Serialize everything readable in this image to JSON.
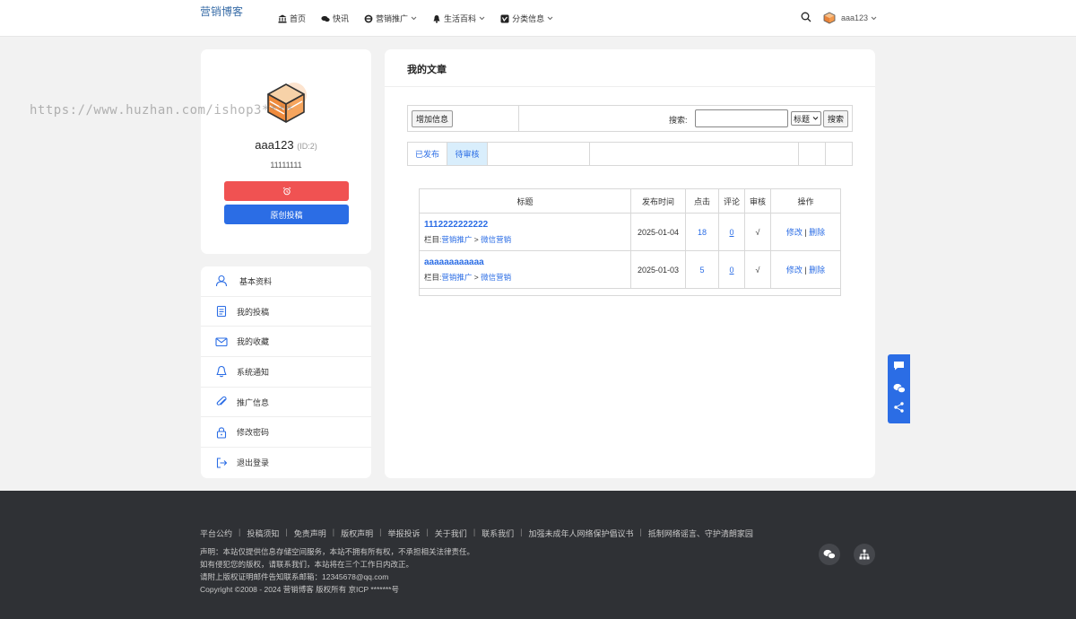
{
  "header": {
    "logo_text": "营销博客",
    "nav": [
      {
        "label": "首页",
        "icon": "bank-icon",
        "dropdown": false
      },
      {
        "label": "快讯",
        "icon": "chat-bubbles-icon",
        "dropdown": false
      },
      {
        "label": "营销推广",
        "icon": "ie-icon",
        "dropdown": true
      },
      {
        "label": "生活百科",
        "icon": "bell-icon",
        "dropdown": true
      },
      {
        "label": "分类信息",
        "icon": "vimeo-icon",
        "dropdown": true
      }
    ],
    "username": "aaa123"
  },
  "profile": {
    "name": "aaa123",
    "id_label": "(ID:2)",
    "description": "11111111",
    "submit_button": "原创投稿"
  },
  "menu": [
    {
      "label": "基本资料",
      "icon": "user-icon"
    },
    {
      "label": "我的投稿",
      "icon": "document-icon"
    },
    {
      "label": "我的收藏",
      "icon": "envelope-icon"
    },
    {
      "label": "系统通知",
      "icon": "bell-outline-icon"
    },
    {
      "label": "推广信息",
      "icon": "paperclip-icon"
    },
    {
      "label": "修改密码",
      "icon": "lock-icon"
    },
    {
      "label": "退出登录",
      "icon": "logout-icon"
    }
  ],
  "main": {
    "title": "我的文章",
    "add_button": "增加信息",
    "search_label": "搜索:",
    "search_value": "",
    "search_field_selected": "标题",
    "search_button": "搜索",
    "tabs": [
      "已发布",
      "待审核"
    ],
    "table": {
      "headers": [
        "标题",
        "发布时间",
        "点击",
        "评论",
        "审核",
        "操作"
      ],
      "category_prefix": "栏目:",
      "rows": [
        {
          "title": "1112222222222",
          "cat1": "营销推广",
          "cat2": "微信营销",
          "date": "2025-01-04",
          "clicks": "18",
          "comments": "0",
          "approved": "√",
          "edit": "修改",
          "delete": "删除"
        },
        {
          "title": "aaaaaaaaaaaa",
          "cat1": "营销推广",
          "cat2": "微信营销",
          "date": "2025-01-03",
          "clicks": "5",
          "comments": "0",
          "approved": "√",
          "edit": "修改",
          "delete": "删除"
        }
      ]
    }
  },
  "footer": {
    "links": [
      "平台公约",
      "投稿须知",
      "免责声明",
      "版权声明",
      "举报投诉",
      "关于我们",
      "联系我们",
      "加强未成年人网络保护倡议书",
      "抵制网络谣言、守护清朗家园"
    ],
    "lines": [
      "声明：本站仅提供信息存储空间服务，本站不拥有所有权，不承担相关法律责任。",
      "如有侵犯您的版权，请联系我们，本站将在三个工作日内改正。",
      "请附上版权证明邮件告知联系邮箱：12345678@qq.com",
      "Copyright ©2008 - 2024 营销博客 版权所有 京ICP *******号"
    ]
  },
  "watermark": "https://www.huzhan.com/ishop3****",
  "colors": {
    "accent": "#2b6de5",
    "danger": "#f05252",
    "footer_bg": "#2f3135"
  }
}
